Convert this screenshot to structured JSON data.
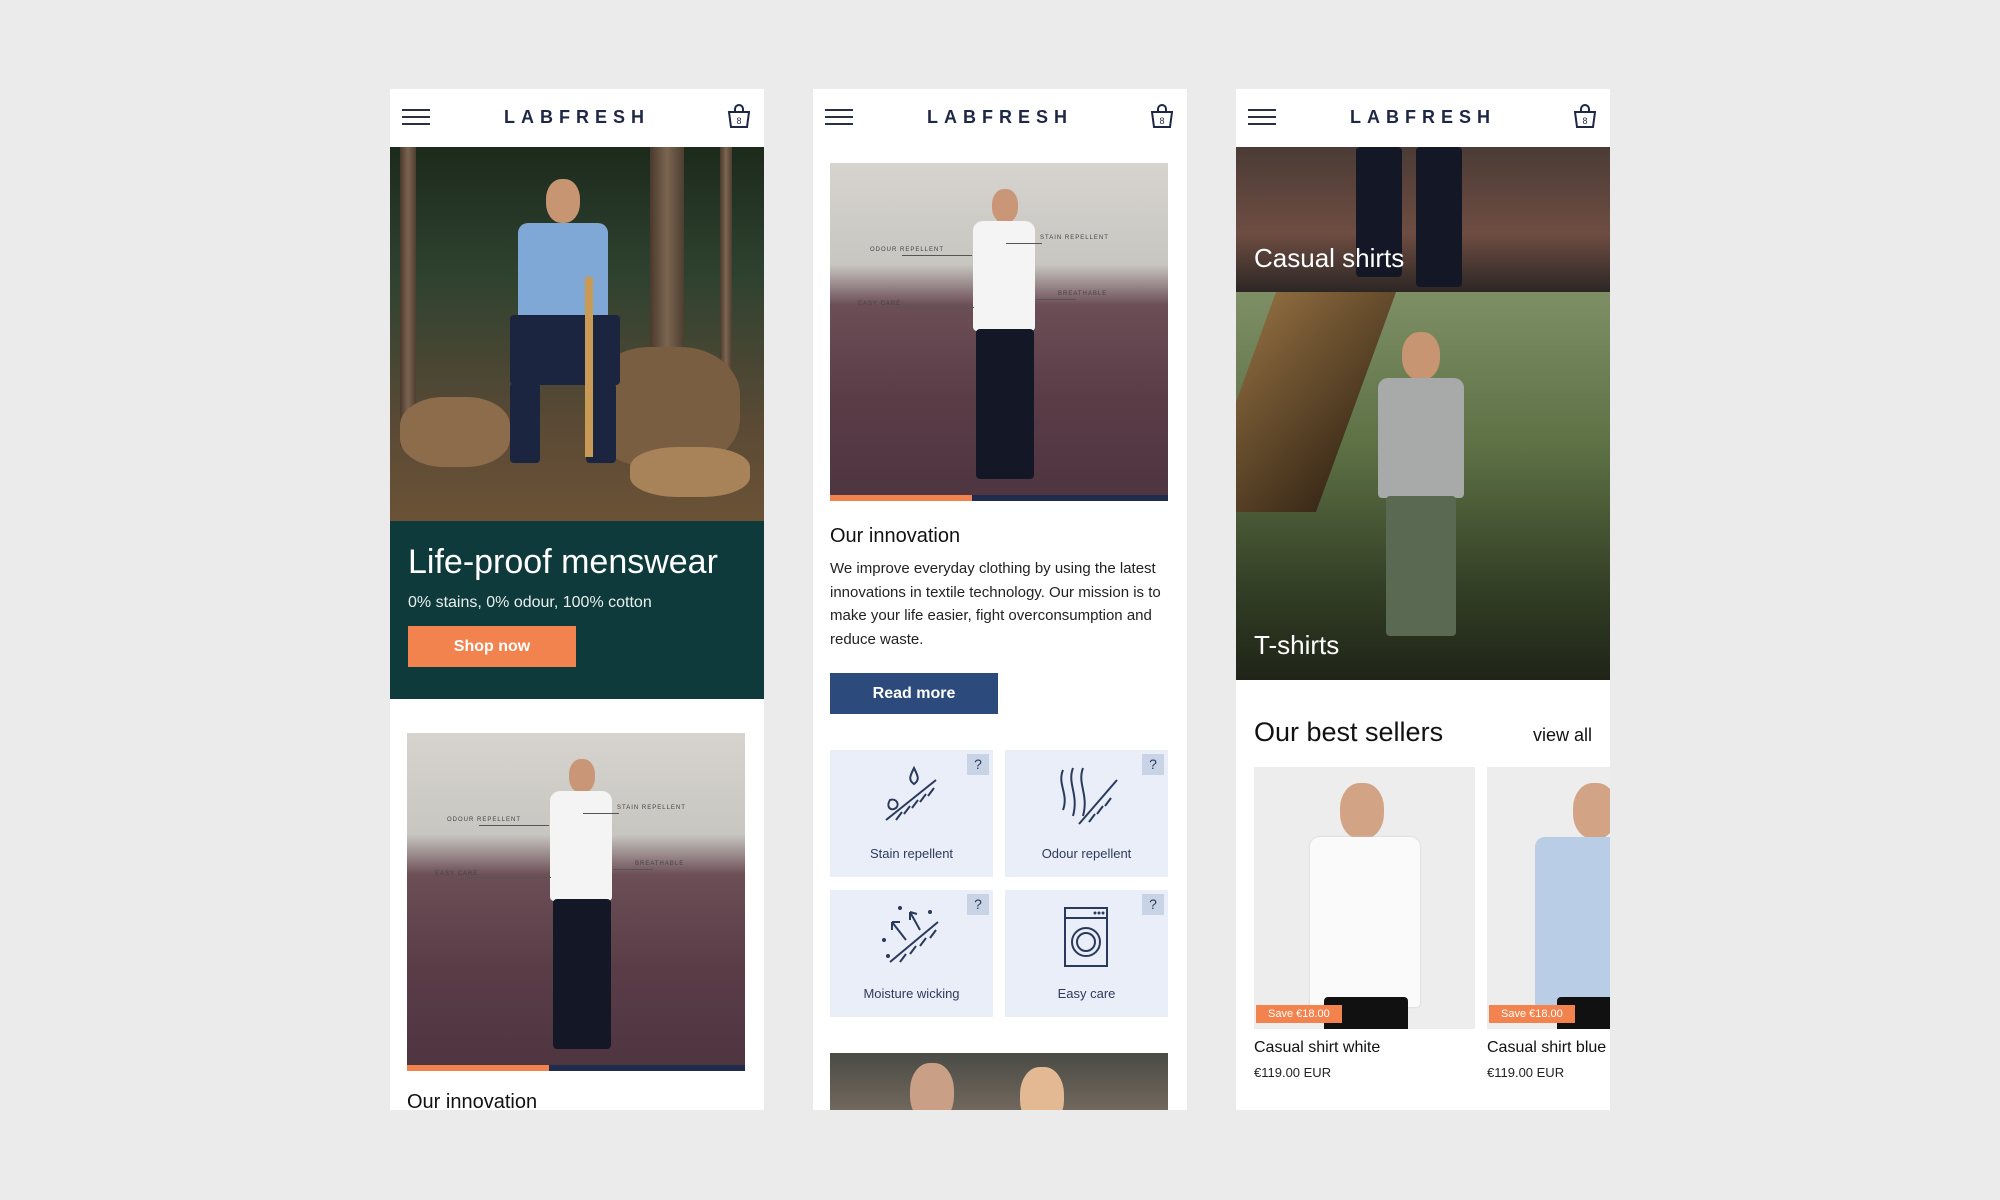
{
  "header": {
    "logo": "LABFRESH",
    "cart_count": "8"
  },
  "hero": {
    "title": "Life-proof menswear",
    "subtitle": "0% stains, 0% odour, 100% cotton",
    "cta": "Shop now"
  },
  "innovation": {
    "title": "Our innovation",
    "text": "We improve everyday clothing by using the latest innovations in textile technology. Our mission is to make your life easier, fight overconsumption and reduce waste.",
    "cta": "Read more",
    "callouts": [
      "ODOUR REPELLENT",
      "STAIN REPELLENT",
      "EASY CARE",
      "BREATHABLE"
    ],
    "progress": 0.42
  },
  "features": [
    {
      "label": "Stain repellent",
      "icon": "stain-icon"
    },
    {
      "label": "Odour repellent",
      "icon": "odour-icon"
    },
    {
      "label": "Moisture wicking",
      "icon": "moisture-icon"
    },
    {
      "label": "Easy care",
      "icon": "washing-machine-icon"
    }
  ],
  "help_label": "?",
  "categories": [
    {
      "label": "Casual shirts"
    },
    {
      "label": "T-shirts"
    }
  ],
  "best_sellers": {
    "title": "Our best sellers",
    "view_all": "view all",
    "products": [
      {
        "name": "Casual shirt white",
        "price": "€119.00 EUR",
        "badge": "Save €18.00"
      },
      {
        "name": "Casual shirt blue",
        "price": "€119.00 EUR",
        "badge": "Save €18.00"
      }
    ]
  },
  "colors": {
    "accent": "#f2834e",
    "navy": "#2c4a7c",
    "teal": "#0f3a3c",
    "tile": "#e9eef8"
  }
}
